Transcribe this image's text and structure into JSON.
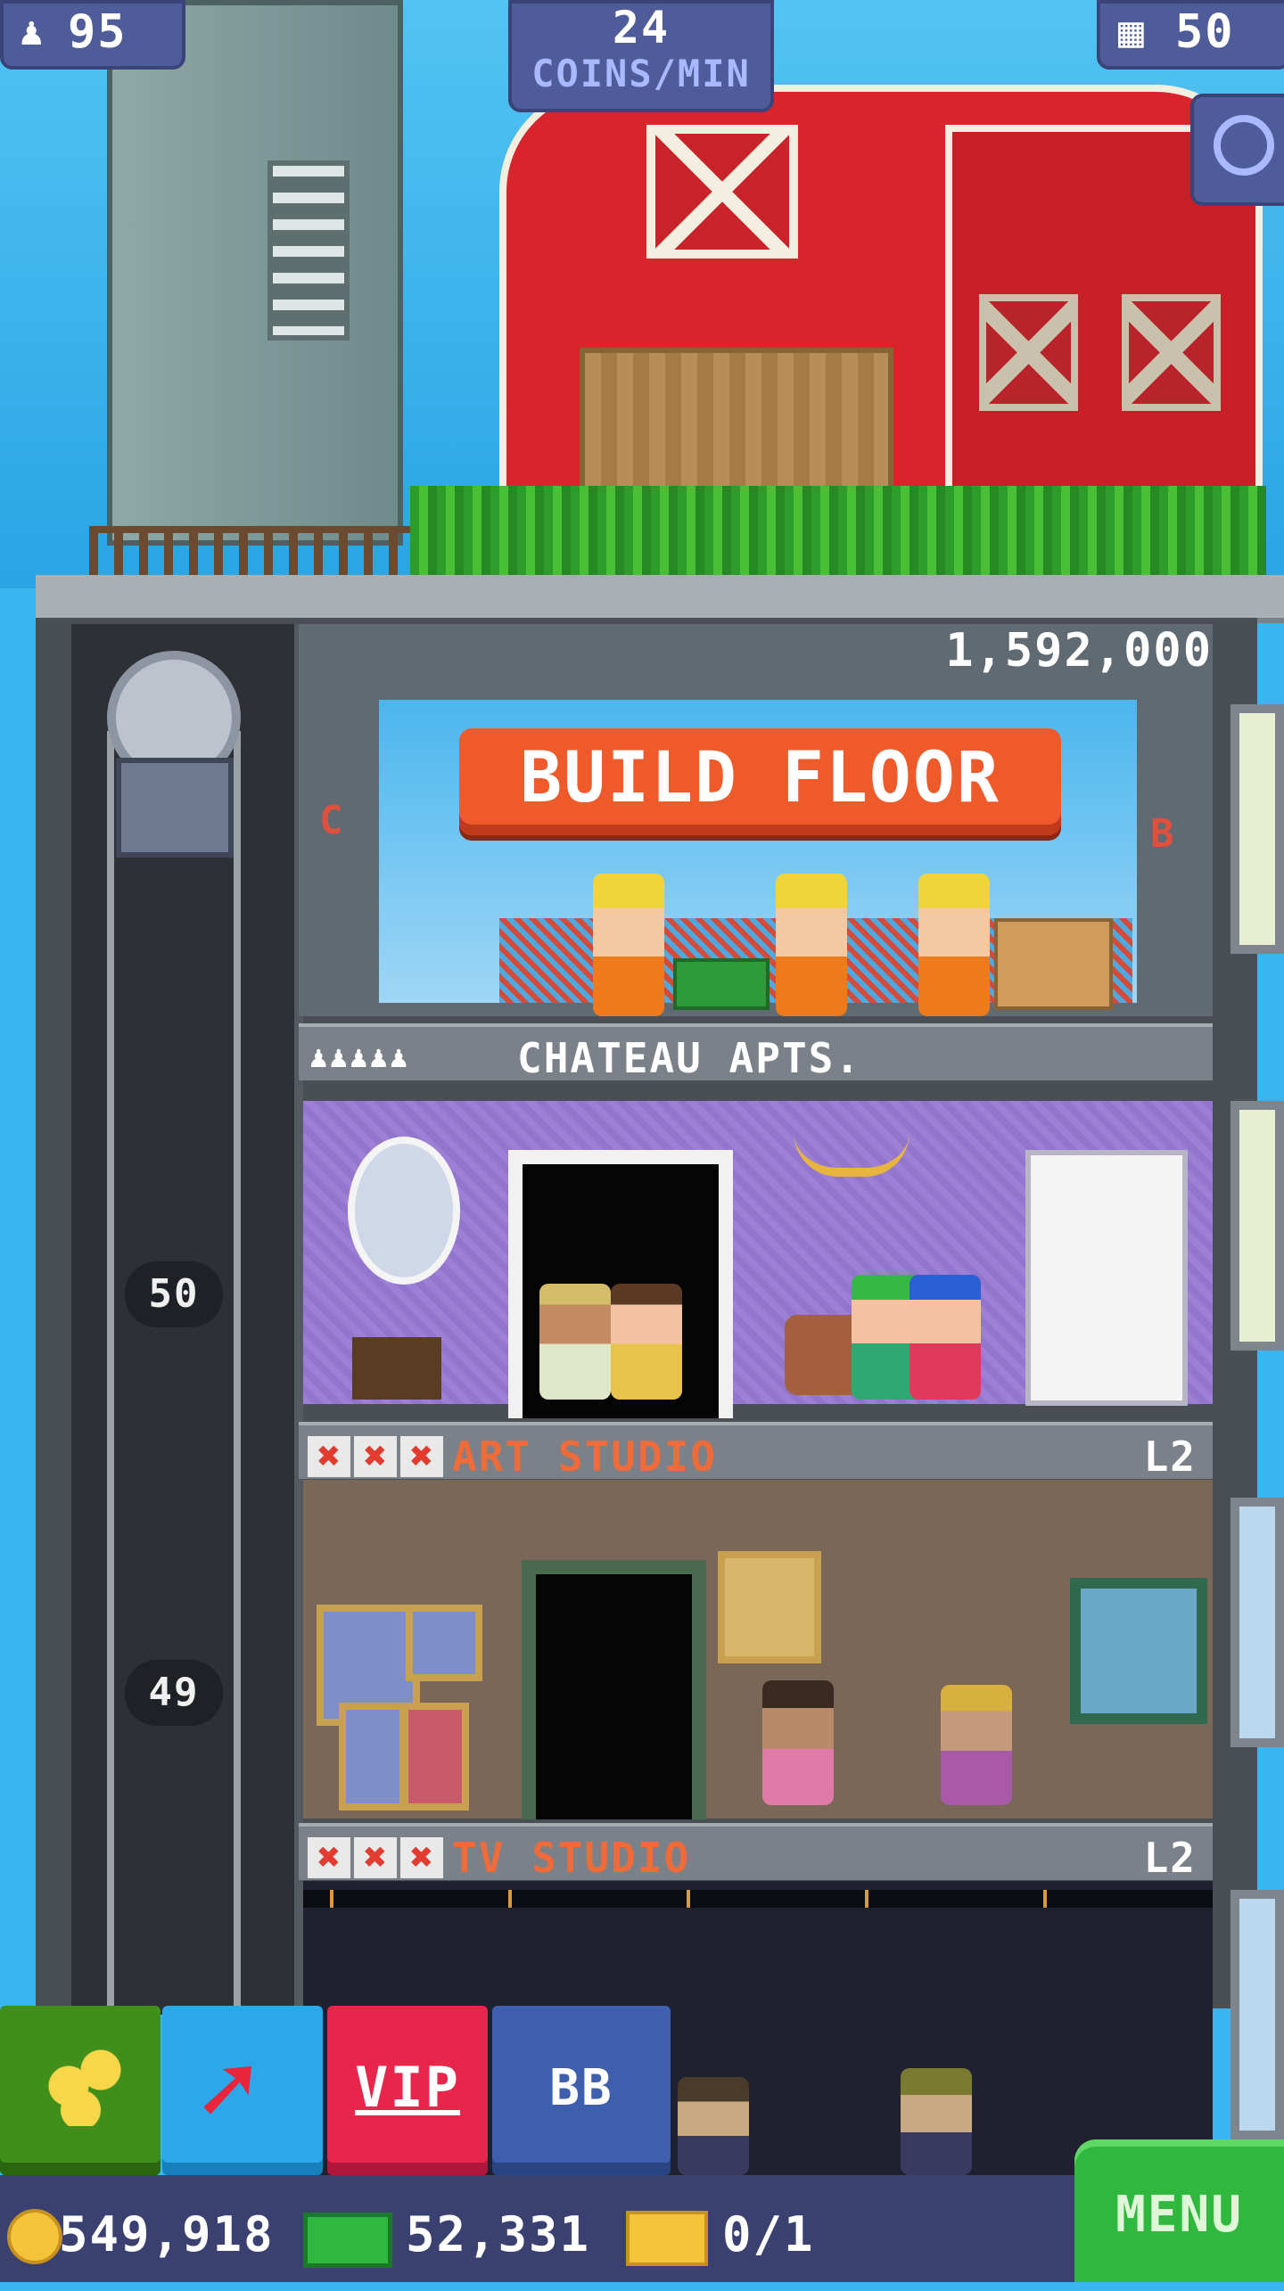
{
  "hud": {
    "population": "95",
    "coins_per_min_value": "24",
    "coins_per_min_label": "COINS/MIN",
    "floors": "50"
  },
  "build": {
    "price": "1,592,000",
    "button_label": "BUILD FLOOR",
    "side_left": "C",
    "side_right": "B"
  },
  "floors": [
    {
      "name": "CHATEAU APTS.",
      "level": "",
      "stars": 0,
      "residents_icons": 5
    },
    {
      "name": "ART STUDIO",
      "level": "L2",
      "stars": 3
    },
    {
      "name": "TV STUDIO",
      "level": "L2",
      "stars": 3
    }
  ],
  "elevator": {
    "floor_markers": [
      "50",
      "49"
    ]
  },
  "toolbar": {
    "vip_label": "VIP",
    "bb_label": "BB"
  },
  "currency": {
    "coins": "549,918",
    "bux": "52,331",
    "tickets": "0/1"
  },
  "menu_label": "MENU",
  "colors": {
    "hud": "#4f5c9a",
    "build_button": "#ee5a2a",
    "menu": "#2fb83d",
    "vip": "#e8254b",
    "coin_button": "#3f8f1a",
    "lift_button": "#2ba7ea",
    "bb_button": "#3d5fae"
  },
  "icons": [
    "population-icon",
    "floors-icon",
    "search-icon",
    "coin-icon",
    "bux-icon",
    "ticket-icon",
    "lift-arrow-icon",
    "coins-stack-icon"
  ]
}
